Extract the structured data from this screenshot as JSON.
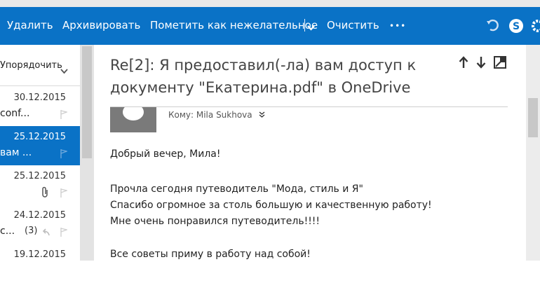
{
  "toolbar": {
    "delete_label": "Удалить",
    "archive_label": "Архивировать",
    "junk_label": "Пометить как нежелательное",
    "sweep_label": "Очистить",
    "more_label": "•••"
  },
  "list": {
    "sort_label": "Упорядочить",
    "items": [
      {
        "date": "30.12.2015",
        "snippet": "conf...",
        "selected": false
      },
      {
        "date": "25.12.2015",
        "snippet": "вам ...",
        "selected": true
      },
      {
        "date": "25.12.2015",
        "snippet": "",
        "selected": false,
        "attachment": true
      },
      {
        "date": "24.12.2015",
        "snippet": "с...",
        "count": "(3)",
        "selected": false,
        "replied": true
      },
      {
        "date": "19.12.2015",
        "snippet": "",
        "selected": false
      }
    ]
  },
  "message": {
    "subject": "Re[2]: Я предоставил(-ла) вам доступ к документу \"Екатерина.pdf\" в OneDrive",
    "to_label": "Кому: Mila Sukhova",
    "body": [
      "Добрый вечер, Мила!",
      "Прочла сегодня путеводитель \"Мода, стиль и Я\"",
      "Спасибо огромное за столь большую и качественную работу!",
      "Мне очень понравился путеводитель!!!!",
      "Все советы  приму в работу над собой!"
    ]
  },
  "colors": {
    "accent": "#0a72c6",
    "toolbar_text": "#ffffff"
  },
  "icons": [
    "undo-icon",
    "skype-icon",
    "gear-icon",
    "arrow-up-icon",
    "arrow-down-icon",
    "popout-icon",
    "chevron-down-icon",
    "flag-icon",
    "paperclip-icon",
    "reply-icon"
  ]
}
